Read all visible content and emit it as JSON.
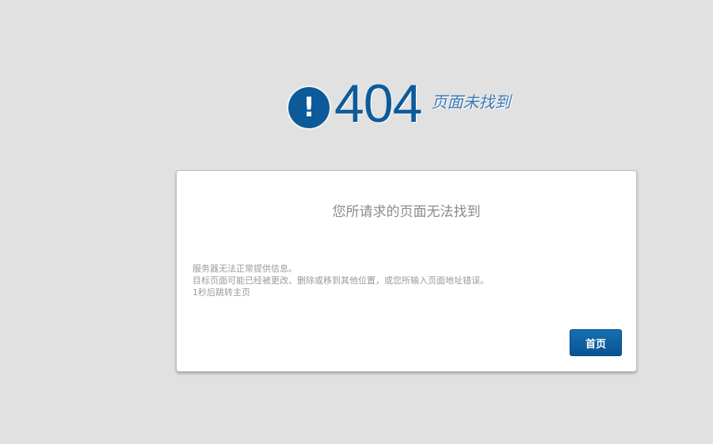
{
  "header": {
    "icon": "exclamation-icon",
    "icon_glyph": "!",
    "code": "404",
    "caption": "页面未找到"
  },
  "card": {
    "title": "您所请求的页面无法找到",
    "lines": [
      "服务器无法正常提供信息。",
      "目标页面可能已经被更改、删除或移到其他位置，或您所输入页面地址错误。",
      "1秒后跳转主页"
    ],
    "home_button_label": "首页"
  },
  "colors": {
    "background": "#e1e1e1",
    "accent": "#0c5a9a",
    "button": "#0a5292"
  }
}
